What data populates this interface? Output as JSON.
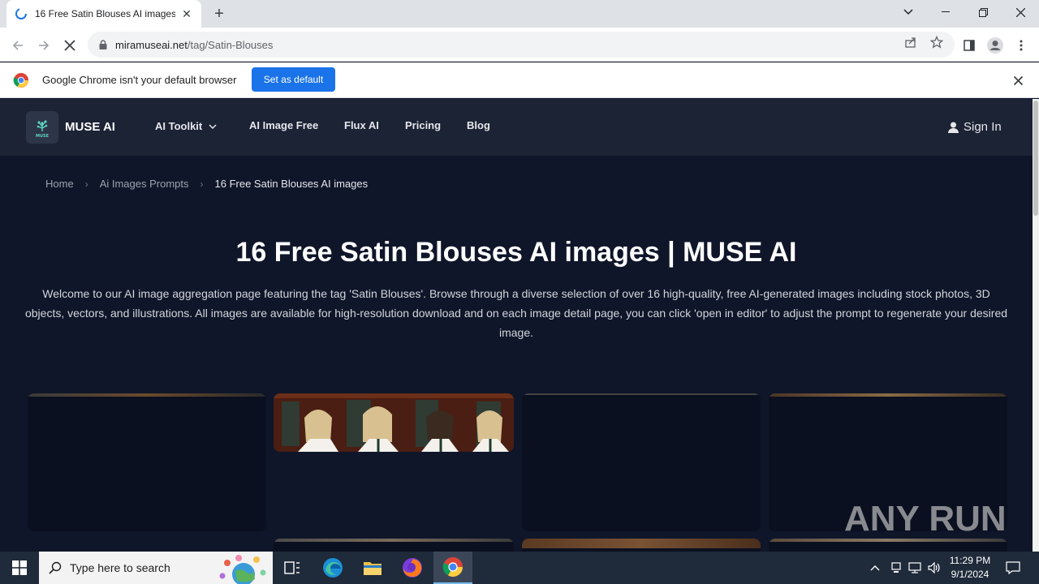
{
  "browser": {
    "tab_title": "16 Free Satin Blouses AI images |",
    "url_host": "miramuseai.net",
    "url_path": "/tag/Satin-Blouses"
  },
  "infobar": {
    "message": "Google Chrome isn't your default browser",
    "button": "Set as default"
  },
  "site": {
    "brand": "MUSE AI",
    "logo_text": "MUSE",
    "nav": [
      "AI Toolkit",
      "AI Image Free",
      "Flux AI",
      "Pricing",
      "Blog"
    ],
    "signin": "Sign In"
  },
  "breadcrumb": [
    "Home",
    "Ai Images Prompts",
    "16 Free Satin Blouses AI images"
  ],
  "heading": "16 Free Satin Blouses AI images | MUSE AI",
  "intro": "Welcome to our AI image aggregation page featuring the tag 'Satin Blouses'. Browse through a diverse selection of over 16 high-quality, free AI-generated images including stock photos, 3D objects, vectors, and illustrations. All images are available for high-resolution download and on each image detail page, you can click 'open in editor' to adjust the prompt to regenerate your desired image.",
  "watermark": "ANY RUN",
  "taskbar": {
    "search_placeholder": "Type here to search",
    "time": "11:29 PM",
    "date": "9/1/2024"
  },
  "colors": {
    "page_bg": "#0f1629",
    "nav_bg": "#1c2335",
    "accent": "#1a73e8"
  }
}
